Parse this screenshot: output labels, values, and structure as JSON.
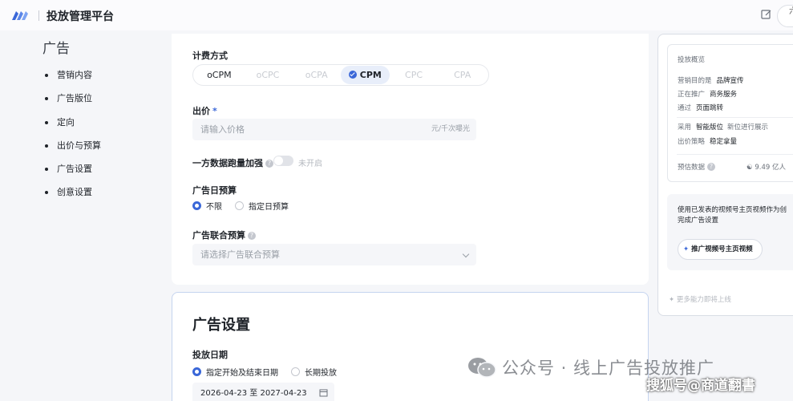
{
  "header": {
    "app_title": "投放管理平台",
    "avatar_text": "六 旧"
  },
  "nav": {
    "heading": "广告",
    "items": [
      "营销内容",
      "广告版位",
      "定向",
      "出价与预算",
      "广告设置",
      "创意设置"
    ]
  },
  "billing": {
    "label": "计费方式",
    "options": [
      {
        "label": "oCPM",
        "state": "enabled"
      },
      {
        "label": "oCPC",
        "state": "disabled"
      },
      {
        "label": "oCPA",
        "state": "disabled"
      },
      {
        "label": "CPM",
        "state": "active"
      },
      {
        "label": "CPC",
        "state": "disabled"
      },
      {
        "label": "CPA",
        "state": "disabled"
      }
    ]
  },
  "bid": {
    "label": "出价",
    "required_mark": "*",
    "placeholder": "请输入价格",
    "suffix": "元/千次曝光"
  },
  "first_party": {
    "label": "一方数据跑量加强",
    "toggle_text": "未开启"
  },
  "daily_budget": {
    "label": "广告日预算",
    "options": [
      "不限",
      "指定日预算"
    ],
    "selected": "不限"
  },
  "joint_budget": {
    "label": "广告联合预算",
    "placeholder": "请选择广告联合预算"
  },
  "ad_settings": {
    "title": "广告设置",
    "date_label": "投放日期",
    "date_options": [
      "指定开始及结束日期",
      "长期投放"
    ],
    "selected": "指定开始及结束日期",
    "date_range": "2026-04-23 至 2027-04-23"
  },
  "summary": {
    "title": "投放概览",
    "lines": [
      {
        "prefix": "营销目的是",
        "value": "品牌宣传"
      },
      {
        "prefix": "正在推广",
        "value": "商务服务"
      },
      {
        "prefix": "通过",
        "value": "页面跳转"
      }
    ],
    "lines2": [
      {
        "prefix": "采用",
        "value": "智能版位",
        "suffix": "新位进行展示"
      },
      {
        "prefix": "出价策略",
        "value": "稳定拿量"
      }
    ],
    "forecast_label": "预估数据",
    "forecast_value": "9.49 亿人"
  },
  "promo": {
    "text_line1": "使用已发表的视频号主页视频作为创",
    "text_line2": "完成广告设置",
    "button_label": "推广视频号主页视频",
    "footer": "更多能力即将上线"
  },
  "watermarks": {
    "wechat": "公众号 · 线上广告投放推广",
    "sohu": "搜狐号@商道翻書"
  },
  "colors": {
    "accent": "#3a67d8",
    "background": "#f5f6f9"
  }
}
